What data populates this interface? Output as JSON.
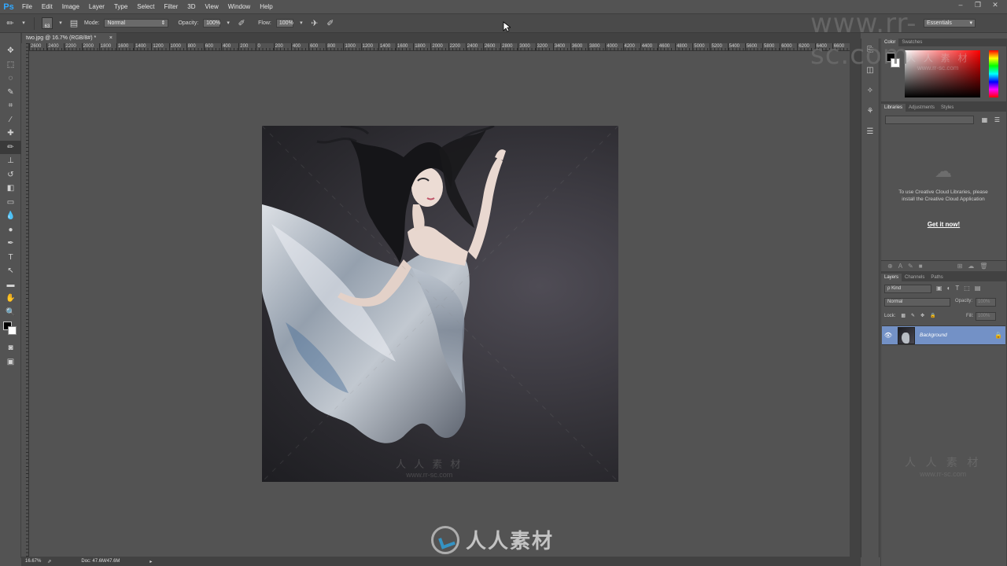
{
  "app": {
    "logo": "Ps",
    "menus": [
      "File",
      "Edit",
      "Image",
      "Layer",
      "Type",
      "Select",
      "Filter",
      "3D",
      "View",
      "Window",
      "Help"
    ],
    "window_controls": [
      "–",
      "❐",
      "✕"
    ]
  },
  "options": {
    "brush_size": "63",
    "mode_label": "Mode:",
    "mode_value": "Normal",
    "opacity_label": "Opacity:",
    "opacity_value": "100%",
    "flow_label": "Flow:",
    "flow_value": "100%",
    "workspace": "Essentials"
  },
  "document": {
    "tab_title": "two.jpg @ 16.7% (RGB/8#) *",
    "tab_close": "×",
    "ruler_ticks": [
      "2600",
      "2400",
      "2200",
      "2000",
      "1800",
      "1600",
      "1400",
      "1200",
      "1000",
      "800",
      "600",
      "400",
      "200",
      "0",
      "200",
      "400",
      "600",
      "800",
      "1000",
      "1200",
      "1400",
      "1600",
      "1800",
      "2000",
      "2200",
      "2400",
      "2600",
      "2800",
      "3000",
      "3200",
      "3400",
      "3600",
      "3800",
      "4000",
      "4200",
      "4400",
      "4600",
      "4800",
      "5000",
      "5200",
      "5400",
      "5600",
      "5800",
      "6000",
      "6200",
      "6400",
      "6600"
    ],
    "zoom": "16.67%",
    "doc_size": "Doc: 47.6M/47.6M",
    "arrow": "▸"
  },
  "tools": [
    {
      "name": "move-tool-icon",
      "glyph": "✥"
    },
    {
      "name": "marquee-tool-icon",
      "glyph": "⬚"
    },
    {
      "name": "lasso-tool-icon",
      "glyph": "◌"
    },
    {
      "name": "quick-selection-tool-icon",
      "glyph": "✎"
    },
    {
      "name": "crop-tool-icon",
      "glyph": "⌗"
    },
    {
      "name": "eyedropper-tool-icon",
      "glyph": "⁄"
    },
    {
      "name": "healing-brush-tool-icon",
      "glyph": "✚"
    },
    {
      "name": "brush-tool-icon",
      "glyph": "✏"
    },
    {
      "name": "clone-stamp-tool-icon",
      "glyph": "⊥"
    },
    {
      "name": "history-brush-tool-icon",
      "glyph": "↺"
    },
    {
      "name": "eraser-tool-icon",
      "glyph": "◧"
    },
    {
      "name": "gradient-tool-icon",
      "glyph": "▭"
    },
    {
      "name": "blur-tool-icon",
      "glyph": "💧"
    },
    {
      "name": "dodge-tool-icon",
      "glyph": "●"
    },
    {
      "name": "pen-tool-icon",
      "glyph": "✒"
    },
    {
      "name": "type-tool-icon",
      "glyph": "T"
    },
    {
      "name": "path-selection-tool-icon",
      "glyph": "↖"
    },
    {
      "name": "rectangle-tool-icon",
      "glyph": "▬"
    },
    {
      "name": "hand-tool-icon",
      "glyph": "✋"
    },
    {
      "name": "zoom-tool-icon",
      "glyph": "🔍"
    }
  ],
  "extra_tools": [
    {
      "name": "quick-mask-icon",
      "glyph": "◙"
    },
    {
      "name": "screen-mode-icon",
      "glyph": "▣"
    }
  ],
  "dock_icons": [
    {
      "name": "history-icon",
      "glyph": "⎘"
    },
    {
      "name": "properties-icon",
      "glyph": "◫"
    },
    {
      "name": "brush-presets-icon",
      "glyph": "✧"
    },
    {
      "name": "clone-source-icon",
      "glyph": "⚘"
    },
    {
      "name": "adjustments-icon",
      "glyph": "☰"
    }
  ],
  "color_panel": {
    "tabs": [
      "Color",
      "Swatches"
    ]
  },
  "libraries_panel": {
    "tabs": [
      "Libraries",
      "Adjustments",
      "Styles"
    ],
    "grid_icon": "▦",
    "list_icon": "☰",
    "message": "To use Creative Cloud Libraries, please install the Creative Cloud Application",
    "link": "Get it now!",
    "footer_icons": [
      "⊕",
      "A",
      "✎",
      "■",
      "",
      "",
      "",
      "⊞",
      "☁",
      "🗑"
    ]
  },
  "layers_panel": {
    "tabs": [
      "Layers",
      "Channels",
      "Paths"
    ],
    "filter_kind": "ρ Kind",
    "filter_icons": [
      "▣",
      "◐",
      "T",
      "⬚",
      "▤"
    ],
    "blend_mode": "Normal",
    "opacity_label": "Opacity:",
    "opacity_value": "100%",
    "lock_label": "Lock:",
    "lock_icons": [
      "▩",
      "✎",
      "✥",
      "🔒"
    ],
    "fill_label": "Fill:",
    "fill_value": "100%",
    "layer_name": "Background",
    "eye": "👁",
    "lock": "🔒"
  },
  "watermark": {
    "url_top": "www.rr-sc.com",
    "logo_text": "人人素材",
    "panel_cn": "人 人 素 材",
    "panel_en": "www.rr-sc.com",
    "color_panel_cn": "人 人 素 材",
    "color_panel_en": "www.rr-sc.com"
  },
  "colors": {
    "ui_bg": "#535353",
    "panel_dark": "#424242",
    "layer_selected": "#7391c6",
    "ps_blue": "#31a8ff"
  }
}
